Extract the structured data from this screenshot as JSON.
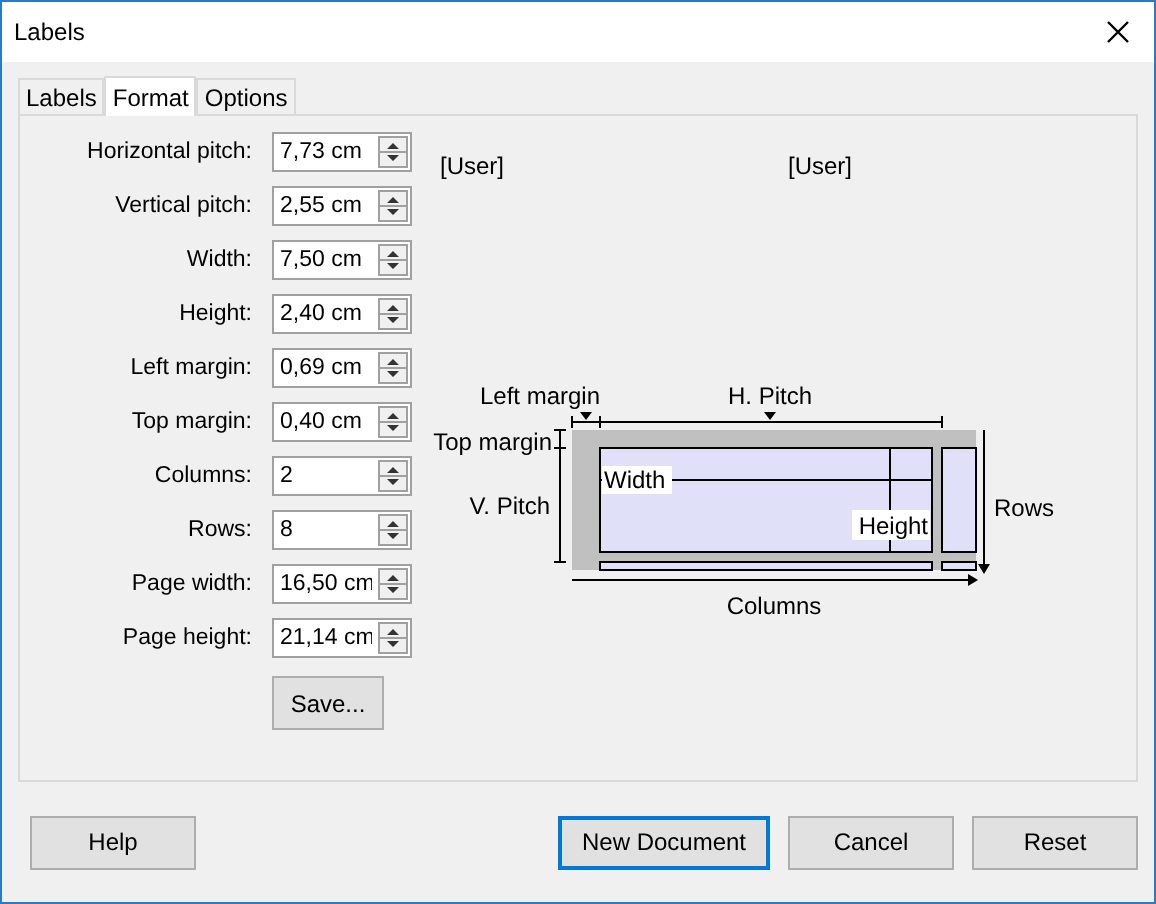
{
  "window": {
    "title": "Labels"
  },
  "tabs": [
    {
      "label": "Labels",
      "selected": false
    },
    {
      "label": "Format",
      "selected": true
    },
    {
      "label": "Options",
      "selected": false
    }
  ],
  "fields": [
    {
      "label": "Horizontal pitch:",
      "value": "7,73 cm"
    },
    {
      "label": "Vertical pitch:",
      "value": "2,55 cm"
    },
    {
      "label": "Width:",
      "value": "7,50 cm"
    },
    {
      "label": "Height:",
      "value": "2,40 cm"
    },
    {
      "label": "Left margin:",
      "value": "0,69 cm"
    },
    {
      "label": "Top margin:",
      "value": "0,40 cm"
    },
    {
      "label": "Columns:",
      "value": "2"
    },
    {
      "label": "Rows:",
      "value": "8"
    },
    {
      "label": "Page width:",
      "value": "16,50 cm"
    },
    {
      "label": "Page height:",
      "value": "21,14 cm"
    }
  ],
  "save_button": "Save...",
  "user_labels": [
    "[User]",
    "[User]"
  ],
  "diagram": {
    "left_margin": "Left margin",
    "h_pitch": "H. Pitch",
    "top_margin": "Top margin",
    "v_pitch": "V. Pitch",
    "width": "Width",
    "height": "Height",
    "rows": "Rows",
    "columns": "Columns"
  },
  "buttons": [
    {
      "label": "Help",
      "default": false,
      "kind": "left"
    },
    {
      "label": "New Document",
      "default": true,
      "kind": "right"
    },
    {
      "label": "Cancel",
      "default": false,
      "kind": "right"
    },
    {
      "label": "Reset",
      "default": false,
      "kind": "right"
    }
  ]
}
